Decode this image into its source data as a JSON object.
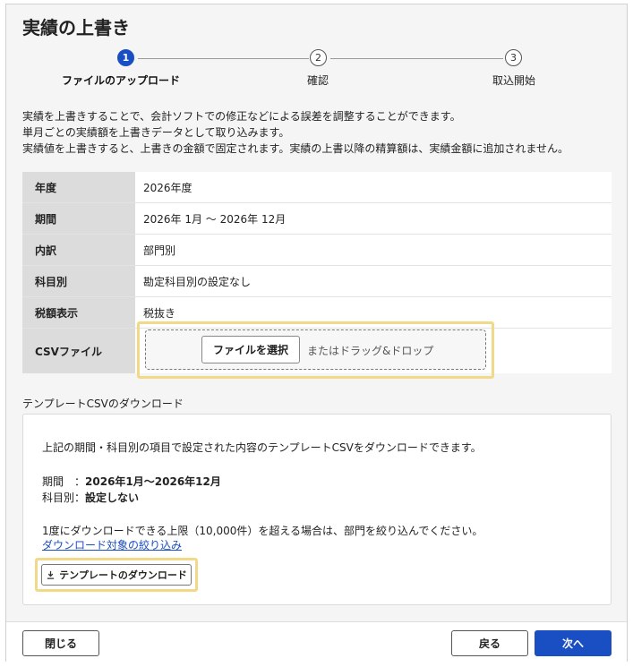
{
  "dialog": {
    "title": "実績の上書き"
  },
  "stepper": {
    "steps": [
      {
        "number": "1",
        "label": "ファイルのアップロード",
        "active": true
      },
      {
        "number": "2",
        "label": "確認",
        "active": false
      },
      {
        "number": "3",
        "label": "取込開始",
        "active": false
      }
    ]
  },
  "description": [
    "実績を上書きすることで、会計ソフトでの修正などによる誤差を調整することができます。",
    "単月ごとの実績額を上書きデータとして取り込みます。",
    "実績値を上書きすると、上書きの金額で固定されます。実績の上書以降の精算額は、実績金額に追加されません。"
  ],
  "form": {
    "rows": [
      {
        "label": "年度",
        "value": "2026年度"
      },
      {
        "label": "期間",
        "value": "2026年 1月 〜 2026年 12月"
      },
      {
        "label": "内訳",
        "value": "部門別"
      },
      {
        "label": "科目別",
        "value": "勘定科目別の設定なし"
      },
      {
        "label": "税額表示",
        "value": "税抜き"
      }
    ],
    "csv": {
      "label": "CSVファイル",
      "button": "ファイルを選択",
      "drop_text": "またはドラッグ&ドロップ"
    }
  },
  "template": {
    "section_title": "テンプレートCSVのダウンロード",
    "intro": "上記の期間・科目別の項目で設定された内容のテンプレートCSVをダウンロードできます。",
    "period_label": "期間　：",
    "period_value": "2026年1月〜2026年12月",
    "account_label": "科目別：",
    "account_value": "設定しない",
    "limit_note": "1度にダウンロードできる上限（10,000件）を超える場合は、部門を絞り込んでください。",
    "filter_link": "ダウンロード対象の絞り込み",
    "download_button": "テンプレートのダウンロード"
  },
  "footer": {
    "close": "閉じる",
    "back": "戻る",
    "next": "次へ"
  },
  "colors": {
    "primary": "#1a4fc4",
    "highlight": "#f2d98a",
    "label_bg": "#dcdcdc"
  }
}
